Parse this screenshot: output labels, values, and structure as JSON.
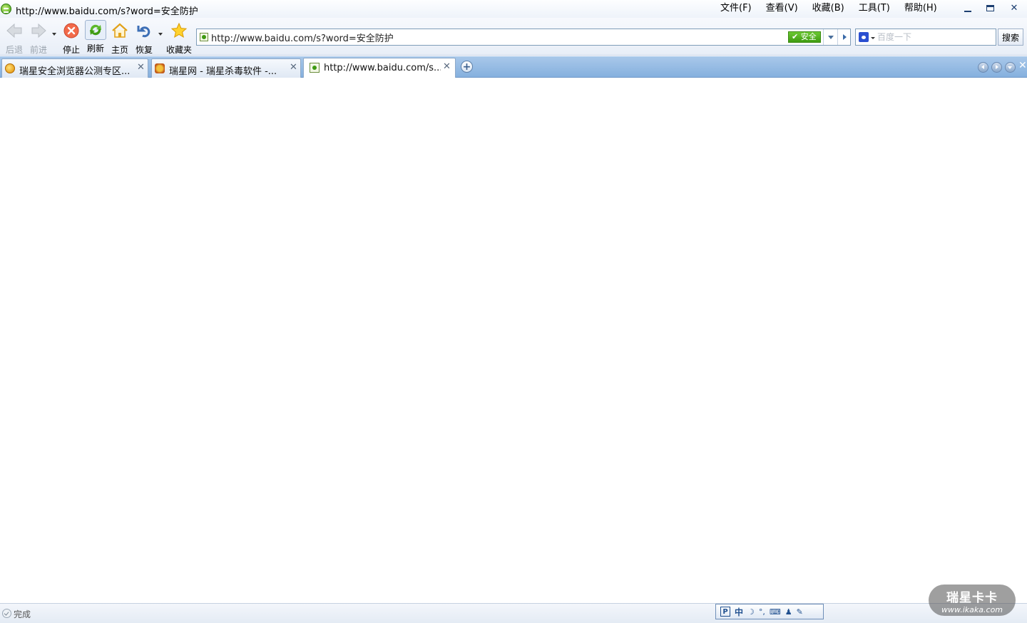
{
  "window": {
    "title": "http://www.baidu.com/s?word=安全防护"
  },
  "menu": {
    "items": [
      {
        "label": "文件(F)"
      },
      {
        "label": "查看(V)"
      },
      {
        "label": "收藏(B)"
      },
      {
        "label": "工具(T)"
      },
      {
        "label": "帮助(H)"
      }
    ]
  },
  "toolbar": {
    "back_label": "后退",
    "forward_label": "前进",
    "stop_label": "停止",
    "refresh_label": "刷新",
    "home_label": "主页",
    "restore_label": "恢复",
    "favorites_label": "收藏夹"
  },
  "address": {
    "url": "http://www.baidu.com/s?word=安全防护",
    "safe_label": "✔ 安全"
  },
  "search": {
    "placeholder": "百度一下",
    "button_label": "搜索"
  },
  "tabs": [
    {
      "title": "瑞星安全浏览器公测专区...",
      "active": false
    },
    {
      "title": "瑞星网 - 瑞星杀毒软件 -...",
      "active": false
    },
    {
      "title": "http://www.baidu.com/s...",
      "active": true
    }
  ],
  "status": {
    "text": "完成"
  },
  "ime": {
    "logo": "P",
    "mode": "中"
  },
  "watermark": {
    "main": "瑞星卡卡",
    "sub": "www.ikaka.com"
  },
  "colors": {
    "tabbar": "#85b0de",
    "safe_badge": "#4fae1c",
    "window_accent": "#1d3f70"
  }
}
